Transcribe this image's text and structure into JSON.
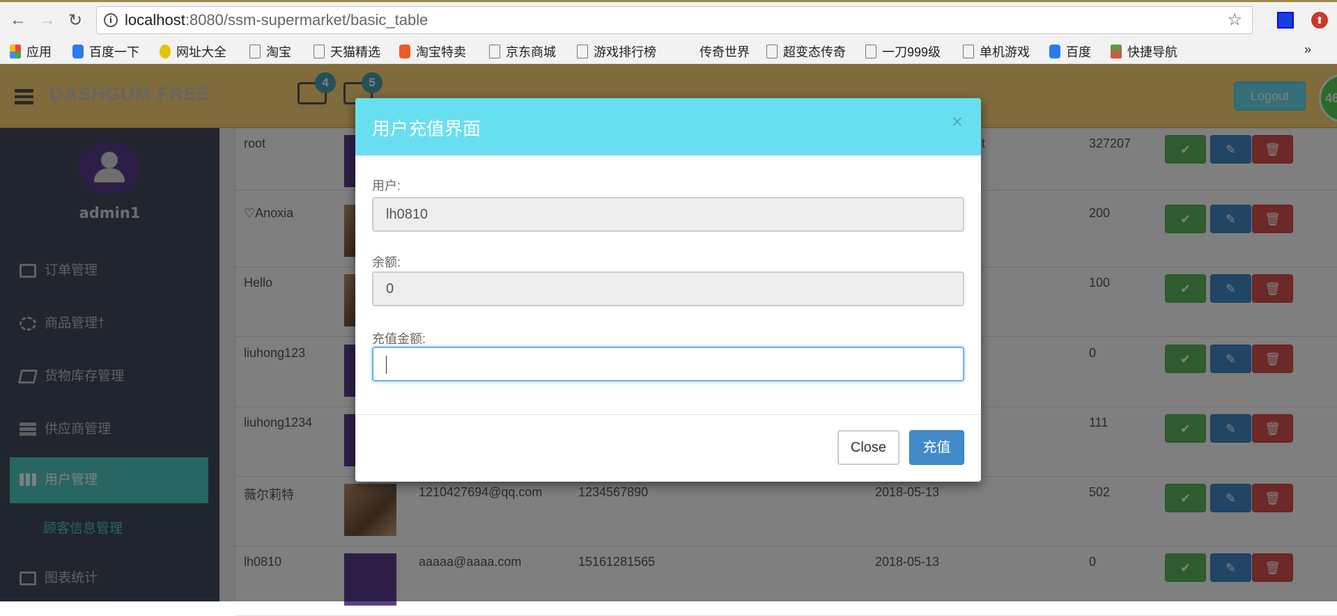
{
  "browser": {
    "url_host": "localhost",
    "url_path": ":8080/ssm-supermarket/basic_table",
    "bookmarks": [
      "应用",
      "百度一下",
      "网址大全",
      "淘宝",
      "天猫精选",
      "淘宝特卖",
      "京东商城",
      "游戏排行榜",
      "传奇世界",
      "超变态传奇",
      "一刀999级",
      "单机游戏",
      "百度",
      "快捷导航"
    ],
    "more": "»"
  },
  "header": {
    "logo": "DASHGUM FREE",
    "tasks_badge": "4",
    "mail_badge": "5",
    "logout": "Logout",
    "floating_badge": "46"
  },
  "sidebar": {
    "username": "admin1",
    "items": [
      {
        "label": "订单管理"
      },
      {
        "label": "商品管理†"
      },
      {
        "label": "货物库存管理"
      },
      {
        "label": "供应商管理"
      },
      {
        "label": "用户管理"
      },
      {
        "label": "图表统计"
      }
    ],
    "subitem": "顾客信息管理"
  },
  "table": {
    "rows": [
      {
        "name": "root",
        "email": "",
        "phone": "",
        "role": "root",
        "date": "",
        "balance": "327207"
      },
      {
        "name": "♡Anoxia",
        "email": "",
        "phone": "",
        "role": "",
        "date": "",
        "balance": "200"
      },
      {
        "name": "Hello",
        "email": "",
        "phone": "",
        "role": "",
        "date": "",
        "balance": "100"
      },
      {
        "name": "liuhong123",
        "email": "",
        "phone": "",
        "role": "",
        "date": "",
        "balance": "0"
      },
      {
        "name": "liuhong1234",
        "email": "",
        "phone": "",
        "role": "",
        "date": "",
        "balance": "111"
      },
      {
        "name": "薇尔莉特",
        "email": "1210427694@qq.com",
        "phone": "1234567890",
        "role": "",
        "date": "2018-05-13",
        "balance": "502"
      },
      {
        "name": "lh0810",
        "email": "aaaaa@aaaa.com",
        "phone": "15161281565",
        "role": "",
        "date": "2018-05-13",
        "balance": "0"
      }
    ]
  },
  "modal": {
    "title": "用户充值界面",
    "close_x": "×",
    "user_label": "用户:",
    "user_value": "lh0810",
    "balance_label": "余额:",
    "balance_value": "0",
    "amount_label": "充值金额:",
    "amount_value": "",
    "close_button": "Close",
    "submit_button": "充值"
  }
}
